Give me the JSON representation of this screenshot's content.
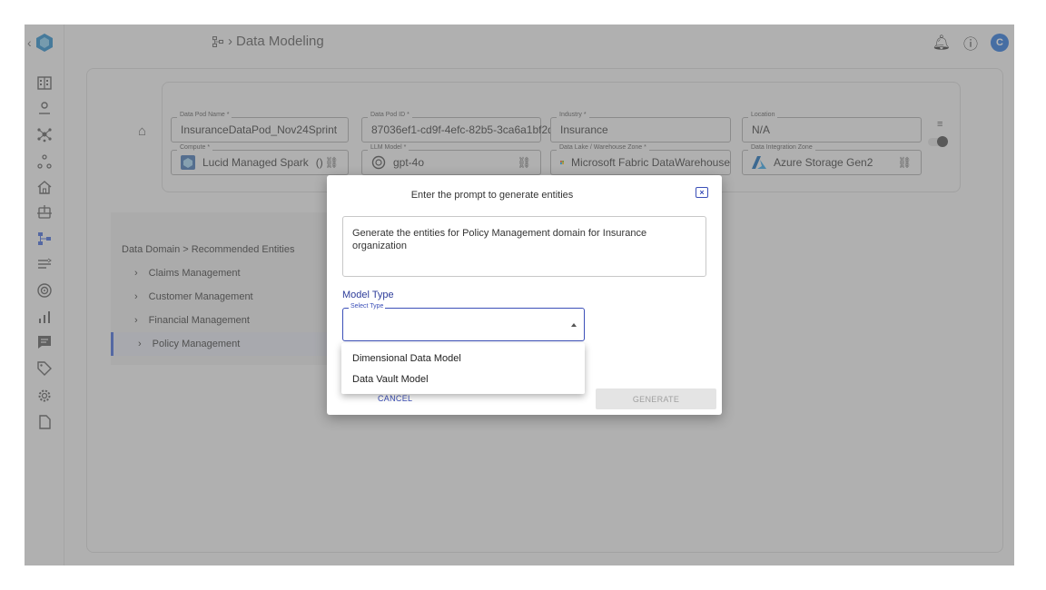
{
  "header": {
    "breadcrumb_page": "Data Modeling",
    "avatar_letter": "C"
  },
  "form": {
    "data_pod_name": {
      "label": "Data Pod Name *",
      "value": "InsuranceDataPod_Nov24Sprint"
    },
    "data_pod_id": {
      "label": "Data Pod ID *",
      "value": "87036ef1-cd9f-4efc-82b5-3ca6a1bf2d"
    },
    "industry": {
      "label": "Industry *",
      "value": "Insurance"
    },
    "location": {
      "label": "Location",
      "value": "N/A"
    },
    "compute": {
      "label": "Compute *",
      "value": "Lucid Managed Spark",
      "extra": "()"
    },
    "llm_model": {
      "label": "LLM Model *",
      "value": "gpt-4o"
    },
    "data_lake": {
      "label": "Data Lake / Warehouse Zone *",
      "value": "Microsoft Fabric DataWarehouse"
    },
    "data_integration": {
      "label": "Data Integration Zone",
      "value": "Azure Storage Gen2"
    }
  },
  "domain_tree": {
    "title": "Data Domain > Recommended Entities",
    "items": [
      {
        "label": "Claims Management"
      },
      {
        "label": "Customer Management"
      },
      {
        "label": "Financial Management"
      },
      {
        "label": "Policy Management"
      }
    ]
  },
  "dialog": {
    "title": "Enter the prompt to generate entities",
    "close_label": "×",
    "prompt_text": "Generate the entities for Policy Management domain for Insurance organization",
    "model_type_label": "Model Type",
    "select_label": "Select Type",
    "options": [
      {
        "label": "Dimensional Data Model"
      },
      {
        "label": "Data Vault Model"
      }
    ],
    "cancel_label": "CANCEL",
    "generate_label": "GENERATE"
  },
  "colors": {
    "accent": "#3b63d8",
    "dialog_accent": "#3b4fb8",
    "avatar": "#1e6fd9"
  },
  "icons": [
    "chevron-left-icon",
    "app-logo-icon",
    "building-icon",
    "user-icon",
    "network-icon",
    "nodes-icon",
    "home-icon",
    "export-icon",
    "data-model-icon",
    "pipeline-icon",
    "target-icon",
    "chart-icon",
    "message-icon",
    "tag-icon",
    "gear-icon",
    "document-icon",
    "bell-icon",
    "help-icon",
    "link-icon"
  ]
}
